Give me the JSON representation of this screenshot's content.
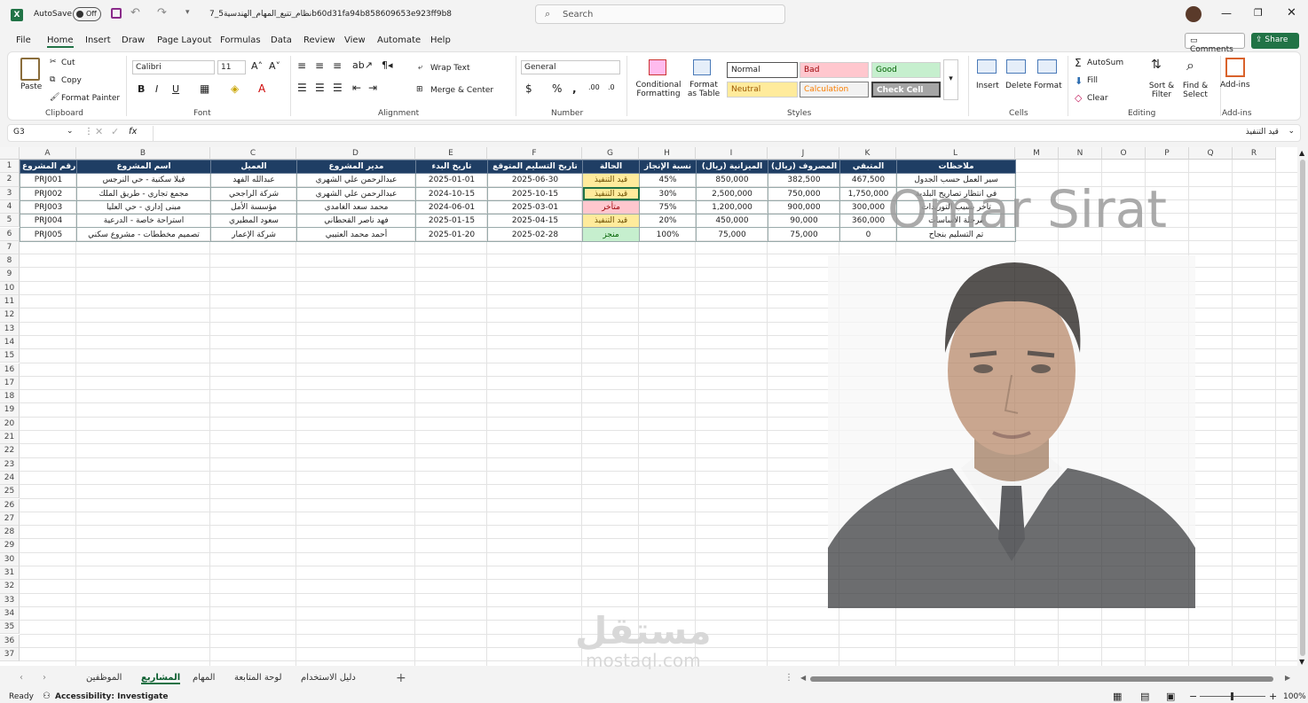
{
  "app": {
    "autosave_label": "AutoSave",
    "autosave_state": "Off",
    "file_name": "7_نظام_تتبع_المهام_الهندسية5b60d31fa94b858609653e923ff9b8",
    "search_placeholder": "Search",
    "window_controls": [
      "minimize-icon",
      "restore-icon",
      "close-icon"
    ]
  },
  "menu": [
    "File",
    "Home",
    "Insert",
    "Draw",
    "Page Layout",
    "Formulas",
    "Data",
    "Review",
    "View",
    "Automate",
    "Help"
  ],
  "comments_label": "Comments",
  "share_label": "Share",
  "ribbon": {
    "clipboard": {
      "paste": "Paste",
      "cut": "Cut",
      "copy": "Copy",
      "format_painter": "Format Painter",
      "label": "Clipboard"
    },
    "font": {
      "name": "Calibri",
      "size": "11",
      "label": "Font"
    },
    "alignment": {
      "wrap": "Wrap Text",
      "merge": "Merge & Center",
      "label": "Alignment"
    },
    "number": {
      "format": "General",
      "label": "Number"
    },
    "styles": {
      "conditional": "Conditional Formatting",
      "format_table": "Format as Table",
      "normal": "Normal",
      "bad": "Bad",
      "good": "Good",
      "neutral": "Neutral",
      "calculation": "Calculation",
      "check_cell": "Check Cell",
      "label": "Styles"
    },
    "cells": {
      "insert": "Insert",
      "delete": "Delete",
      "format": "Format",
      "label": "Cells"
    },
    "editing": {
      "autosum": "AutoSum",
      "fill": "Fill",
      "clear": "Clear",
      "sort": "Sort & Filter",
      "find": "Find & Select",
      "label": "Editing"
    },
    "addins": {
      "addins": "Add-ins",
      "label": "Add-ins"
    }
  },
  "formula_bar": {
    "name_box": "G3",
    "fx": "fx",
    "content": "قيد التنفيذ"
  },
  "columns": [
    "A",
    "B",
    "C",
    "D",
    "E",
    "F",
    "G",
    "H",
    "I",
    "J",
    "K",
    "L",
    "M",
    "N",
    "O",
    "P",
    "Q",
    "R"
  ],
  "table": {
    "headers": [
      "رقم المشروع",
      "اسم المشروع",
      "العميل",
      "مدير المشروع",
      "تاريخ البدء",
      "تاريخ التسليم المتوقع",
      "الحالة",
      "نسبة الإنجاز",
      "الميزانية (ريال)",
      "المصروف (ريال)",
      "المتبقي",
      "ملاحظات"
    ],
    "rows": [
      [
        "PRJ001",
        "فيلا سكنية - حي النرجس",
        "عبدالله الفهد",
        "عبدالرحمن علي الشهري",
        "2025-01-01",
        "2025-06-30",
        "قيد التنفيذ",
        "45%",
        "850,000",
        "382,500",
        "467,500",
        "سير العمل حسب الجدول"
      ],
      [
        "PRJ002",
        "مجمع تجاري - طريق الملك",
        "شركة الراجحي",
        "عبدالرحمن علي الشهري",
        "2024-10-15",
        "2025-10-15",
        "قيد التنفيذ",
        "30%",
        "2,500,000",
        "750,000",
        "1,750,000",
        "في انتظار تصاريح البلدية"
      ],
      [
        "PRJ003",
        "مبنى إداري - حي العليا",
        "مؤسسة الأمل",
        "محمد سعد الغامدي",
        "2024-06-01",
        "2025-03-01",
        "متأخر",
        "75%",
        "1,200,000",
        "900,000",
        "300,000",
        "تأخر بسبب التوريدات"
      ],
      [
        "PRJ004",
        "استراحة خاصة - الدرعية",
        "سعود المطيري",
        "فهد ناصر القحطاني",
        "2025-01-15",
        "2025-04-15",
        "قيد التنفيذ",
        "20%",
        "450,000",
        "90,000",
        "360,000",
        "مرحلة الأساسات"
      ],
      [
        "PRJ005",
        "تصميم مخططات - مشروع سكني",
        "شركة الإعمار",
        "أحمد محمد العتيبي",
        "2025-01-20",
        "2025-02-28",
        "منجز",
        "100%",
        "75,000",
        "75,000",
        "0",
        "تم التسليم بنجاح"
      ]
    ]
  },
  "row_count": 37,
  "overlay": {
    "name": "Omar Sirat",
    "brand": "مستقل",
    "brand_url": "mostaql.com"
  },
  "sheets": [
    "الموظفين",
    "المشاريع",
    "المهام",
    "لوحة المتابعة",
    "دليل الاستخدام"
  ],
  "active_sheet": "المشاريع",
  "status": {
    "ready": "Ready",
    "accessibility": "Accessibility: Investigate",
    "zoom": "100%"
  }
}
